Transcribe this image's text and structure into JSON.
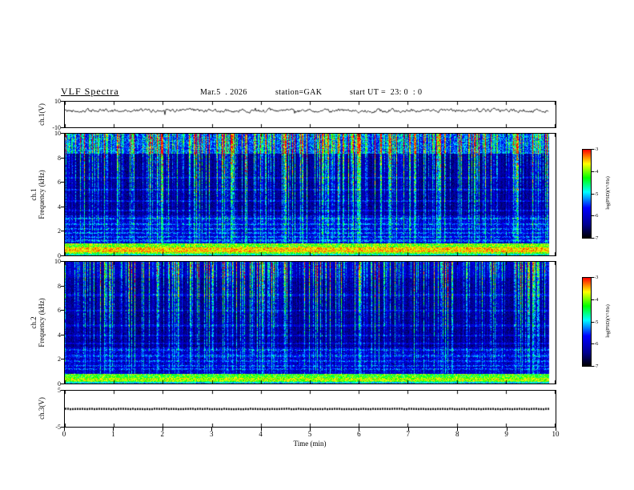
{
  "header": {
    "title": "VLF Spectra",
    "date": "Mar.5  . 2026",
    "station": "station=GAK",
    "start_ut": "start UT =  23: 0  : 0"
  },
  "xaxis": {
    "label": "Time (min)",
    "range": [
      0,
      10
    ],
    "ticks": [
      0,
      1,
      2,
      3,
      4,
      5,
      6,
      7,
      8,
      9,
      10
    ],
    "data_end_min": 9.8
  },
  "colorbar": {
    "label": "log(PSD)(V²/Hz)",
    "ticks": [
      -3,
      -4,
      -5,
      -6,
      -7
    ],
    "value_range": [
      -7,
      -3
    ],
    "stops": [
      {
        "pos": 1.0,
        "color": "#ff0000"
      },
      {
        "pos": 0.84,
        "color": "#ffff00"
      },
      {
        "pos": 0.68,
        "color": "#00ff00"
      },
      {
        "pos": 0.52,
        "color": "#00ffff"
      },
      {
        "pos": 0.34,
        "color": "#0000ff"
      },
      {
        "pos": 0.15,
        "color": "#000090"
      },
      {
        "pos": 0.0,
        "color": "#000000"
      }
    ]
  },
  "chart_data": [
    {
      "type": "line",
      "panel": "ch1-waveform",
      "ylabel": "ch.1(V)",
      "ylim": [
        -10,
        10
      ],
      "yticks": [
        10,
        -10
      ],
      "xlim": [
        0,
        10
      ],
      "description": "Noisy broadband voltage waveform fluctuating around +3 V with ±2-4 V excursions, spanning 0 to 9.8 min",
      "render": {
        "seed": 42,
        "mean": 3.0,
        "noise": 1.05,
        "spike_prob": 0.012,
        "spike_amp": 3.5
      }
    },
    {
      "type": "heatmap",
      "panel": "ch1-spectrogram",
      "channel_label": "ch.1",
      "ylabel": "Frequency (kHz)",
      "ylim": [
        0,
        10
      ],
      "yticks": [
        0,
        2,
        4,
        6,
        8,
        10
      ],
      "xlim": [
        0,
        10
      ],
      "value_range": [
        -7,
        -3
      ],
      "description": "VLF spectrogram ch.1: intense red/yellow/green horizontal band below 1 kHz, blue noise and horizontal hum lines between 1 and 3.3 kHz, dense cyan/green vertical sferic streaks strongest above 6 kHz, near-solid green/cyan layer at 8.4-10 kHz, dark background elsewhere",
      "render": {
        "seed": 1337,
        "noise_floor": 0.06,
        "noise_rand": 0.15,
        "lowmid_cut": 3.3,
        "lowmid_extra": 0.2,
        "hum_lines": [
          1.25,
          1.55,
          1.85,
          2.2,
          2.6,
          3.05,
          3.7,
          4.5,
          5.4,
          6.4
        ],
        "hum_strength": 0.14,
        "streak_power": 2.6,
        "streak_gain": 0.95,
        "strong_prob": 0.02,
        "top_from": 8.4,
        "top_extra": 0.26,
        "band_lo": 0.18,
        "band_hi": 1.05,
        "band_base": 0.58,
        "band_noise": 0.32,
        "core_lo": 0.3,
        "core_hi": 0.7,
        "core_base": 0.76,
        "core_noise": 0.22,
        "band0_base": 0.42,
        "band0_noise": 0.25
      }
    },
    {
      "type": "heatmap",
      "panel": "ch2-spectrogram",
      "channel_label": "ch.2",
      "ylabel": "Frequency (kHz)",
      "ylim": [
        0,
        10
      ],
      "yticks": [
        0,
        2,
        4,
        6,
        8,
        10
      ],
      "xlim": [
        0,
        10
      ],
      "value_range": [
        -7,
        -3
      ],
      "description": "VLF spectrogram ch.2: bright yellow/green band below 0.85 kHz, blue noise with hum lines 1-3 kHz, blue/cyan vertical sferic streaks of moderate density, darker at high frequency than ch.1",
      "render": {
        "seed": 9001,
        "noise_floor": 0.06,
        "noise_rand": 0.15,
        "lowmid_cut": 3.0,
        "lowmid_extra": 0.18,
        "hum_lines": [
          1.2,
          1.5,
          1.9,
          2.3,
          2.8,
          3.3,
          4.0,
          4.8,
          6.0,
          7.3
        ],
        "hum_strength": 0.12,
        "streak_power": 3.0,
        "streak_gain": 0.82,
        "strong_prob": 0.015,
        "top_from": 8.7,
        "top_extra": 0.08,
        "band_lo": 0.15,
        "band_hi": 0.85,
        "band_base": 0.55,
        "band_noise": 0.3,
        "core_lo": 0.2,
        "core_hi": 0.5,
        "core_base": 0.66,
        "core_noise": 0.24,
        "band0_base": 0.4,
        "band0_noise": 0.22
      }
    },
    {
      "type": "line",
      "panel": "ch3-flat",
      "ylabel": "ch.3(V)",
      "ylim": [
        -5,
        5
      ],
      "yticks": [
        5,
        -5
      ],
      "xlim": [
        0,
        10
      ],
      "description": "Flat dotted trace constant at 0 V across 0 to 9.8 min",
      "render": {
        "seed": 7,
        "mean": 0,
        "noise": 0
      }
    }
  ]
}
